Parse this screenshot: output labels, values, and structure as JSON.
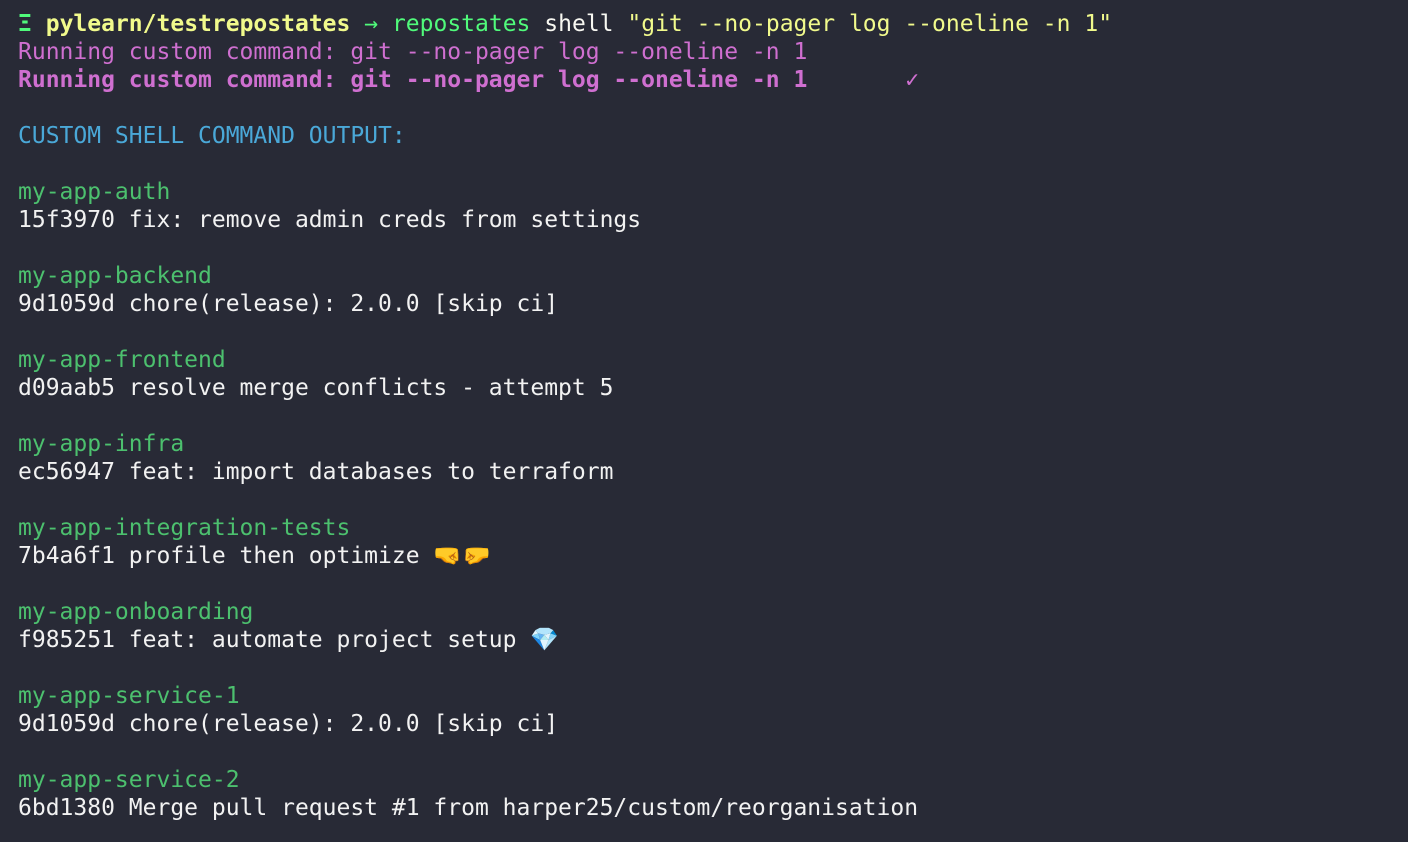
{
  "prompt": {
    "glyph": "Ξ",
    "path": "pylearn/testrepostates",
    "arrow": "→",
    "branch": "repostates",
    "command": "shell",
    "argument": "\"git --no-pager log --oneline -n 1\""
  },
  "running": {
    "line1": "Running custom command: git --no-pager log --oneline -n 1",
    "line2": "Running custom command: git --no-pager log --oneline -n 1",
    "check": "✓"
  },
  "output_header": "CUSTOM SHELL COMMAND OUTPUT:",
  "repos": [
    {
      "name": "my-app-auth",
      "commit": "15f3970 fix: remove admin creds from settings"
    },
    {
      "name": "my-app-backend",
      "commit": "9d1059d chore(release): 2.0.0 [skip ci]"
    },
    {
      "name": "my-app-frontend",
      "commit": "d09aab5 resolve merge conflicts - attempt 5"
    },
    {
      "name": "my-app-infra",
      "commit": "ec56947 feat: import databases to terraform"
    },
    {
      "name": "my-app-integration-tests",
      "commit": "7b4a6f1 profile then optimize 🤜🤛"
    },
    {
      "name": "my-app-onboarding",
      "commit": "f985251 feat: automate project setup 💎"
    },
    {
      "name": "my-app-service-1",
      "commit": "9d1059d chore(release): 2.0.0 [skip ci]"
    },
    {
      "name": "my-app-service-2",
      "commit": "6bd1380 Merge pull request #1 from harper25/custom/reorganisation"
    }
  ]
}
